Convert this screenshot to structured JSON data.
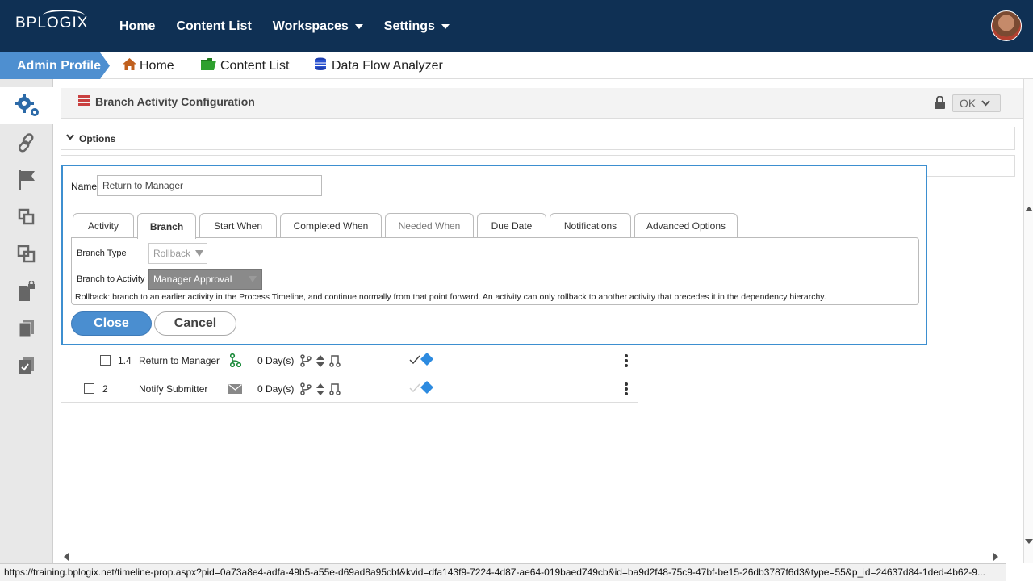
{
  "header": {
    "logo": "BPLOGIX",
    "nav": [
      {
        "label": "Home"
      },
      {
        "label": "Content List"
      },
      {
        "label": "Workspaces"
      },
      {
        "label": "Settings"
      }
    ]
  },
  "breadcrumb": {
    "active": "Admin Profile",
    "items": [
      {
        "label": "Home",
        "icon": "home-icon"
      },
      {
        "label": "Content List",
        "icon": "folder-icon"
      },
      {
        "label": "Data Flow Analyzer",
        "icon": "database-icon"
      }
    ]
  },
  "sidebar": {
    "items": [
      "gears-icon",
      "link-icon",
      "flag-icon",
      "copy-icon",
      "duplicate-icon",
      "locked-document-icon",
      "documents-icon",
      "check-document-icon"
    ]
  },
  "panel": {
    "title": "Branch Activity Configuration",
    "ok_label": "OK",
    "options_label": "Options"
  },
  "modal": {
    "name_label": "Name",
    "name_value": "Return to Manager",
    "tabs": [
      {
        "label": "Activity"
      },
      {
        "label": "Branch"
      },
      {
        "label": "Start When"
      },
      {
        "label": "Completed When"
      },
      {
        "label": "Needed When"
      },
      {
        "label": "Due Date"
      },
      {
        "label": "Notifications"
      },
      {
        "label": "Advanced Options"
      }
    ],
    "branch_type_label": "Branch Type",
    "branch_type_value": "Rollback",
    "branch_to_activity_label": "Branch to Activity",
    "branch_to_activity_value": "Manager Approval",
    "description": "Rollback: branch to an earlier activity in the Process Timeline, and continue normally from that point forward. An activity can only rollback to another activity that precedes it in the dependency hierarchy.",
    "close_label": "Close",
    "cancel_label": "Cancel"
  },
  "table": {
    "rows": [
      {
        "num": "1.4",
        "name": "Return to Manager",
        "days": "0 Day(s)",
        "type_icon": "branch-icon"
      },
      {
        "num": "2",
        "name": "Notify Submitter",
        "days": "0 Day(s)",
        "type_icon": "email-icon"
      }
    ]
  },
  "status_url": "https://training.bplogix.net/timeline-prop.aspx?pid=0a73a8e4-adfa-49b5-a55e-d69ad8a95cbf&kvid=dfa143f9-7224-4d87-ae64-019baed749cb&id=ba9d2f48-75c9-47bf-be15-26db3787f6d3&type=55&p_id=24637d84-1ded-4b62-9...",
  "colors": {
    "topbar": "#0f3054",
    "accent": "#4a8ed0",
    "sidebar": "#e8e8e8"
  }
}
